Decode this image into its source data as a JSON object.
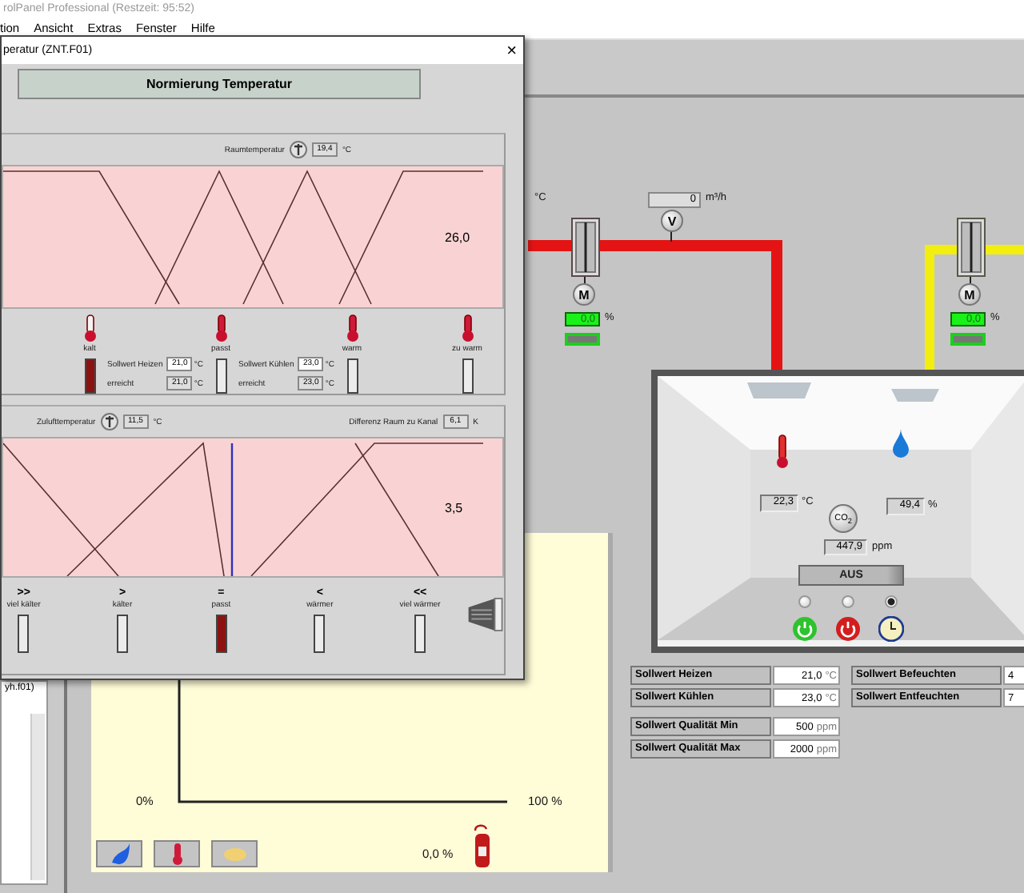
{
  "app": {
    "title": "rolPanel Professional (Restzeit: 95:52)",
    "menu": [
      "tion",
      "Ansicht",
      "Extras",
      "Fenster",
      "Hilfe"
    ]
  },
  "sidebar": {
    "items": [
      "yh.f01)"
    ]
  },
  "schematic": {
    "supply_unit": "°C",
    "flow": {
      "value": "0",
      "unit": "m³/h",
      "sensor": "V"
    },
    "dampers": [
      {
        "kind": "heating",
        "motor": "M",
        "reading": "0,0",
        "unit": "%"
      },
      {
        "kind": "cooling",
        "motor": "M",
        "reading": "0,0",
        "unit": "%"
      }
    ],
    "room": {
      "temperature": "22,3",
      "temperature_unit": "°C",
      "humidity": "49,4",
      "humidity_unit": "%",
      "co2_label": "CO$_{2}$",
      "co2": "447,9",
      "co2_unit": "ppm",
      "mode_button": "AUS",
      "modes": [
        {
          "kind": "on",
          "selected": false
        },
        {
          "kind": "off",
          "selected": false
        },
        {
          "kind": "timer",
          "selected": true
        }
      ]
    },
    "setpoints": [
      {
        "label": "Sollwert Heizen",
        "value": "21,0",
        "unit": "°C"
      },
      {
        "label": "Sollwert Kühlen",
        "value": "23,0",
        "unit": "°C"
      },
      {
        "label": "Sollwert Qualität Min",
        "value": "500",
        "unit": "ppm"
      },
      {
        "label": "Sollwert Qualität Max",
        "value": "2000",
        "unit": "ppm"
      }
    ],
    "setpoints_right": [
      {
        "label": "Sollwert Befeuchten",
        "value": "4"
      },
      {
        "label": "Sollwert Entfeuchten",
        "value": "7"
      }
    ],
    "chart": {
      "x_min": "0%",
      "x_max": "100 %",
      "reading": "0,0 %",
      "buttons": [
        {
          "kind": "humidity"
        },
        {
          "kind": "temperature"
        },
        {
          "kind": "co2"
        }
      ]
    }
  },
  "dialog": {
    "title": "peratur (ZNT.F01)",
    "close": "×",
    "heading": "Normierung Temperatur",
    "room": {
      "label": "Raumtemperatur",
      "value": "19,4",
      "unit": "°C",
      "scale_max": "26,0",
      "classes": [
        {
          "label": "kalt",
          "on": true
        },
        {
          "label": "passt",
          "on": false
        },
        {
          "label": "warm",
          "on": false
        },
        {
          "label": "zu warm",
          "on": false
        }
      ],
      "setpoints": [
        {
          "label": "Sollwert Heizen",
          "value": "21,0",
          "unit": "°C",
          "reached_label": "erreicht",
          "reached": "21,0",
          "reached_unit": "°C"
        },
        {
          "label": "Sollwert Kühlen",
          "value": "23,0",
          "unit": "°C",
          "reached_label": "erreicht",
          "reached": "23,0",
          "reached_unit": "°C"
        }
      ]
    },
    "supply": {
      "label": "Zulufttemperatur",
      "value": "11,5",
      "unit": "°C",
      "diff_label": "Differenz Raum zu Kanal",
      "diff": "6,1",
      "diff_unit": "K",
      "scale_max": "3,5",
      "classes": [
        {
          "symbol": ">>",
          "label": "viel kälter",
          "on": false
        },
        {
          "symbol": ">",
          "label": "kälter",
          "on": false
        },
        {
          "symbol": "=",
          "label": "passt",
          "on": true
        },
        {
          "symbol": "<",
          "label": "wärmer",
          "on": false
        },
        {
          "symbol": "<<",
          "label": "viel wärmer",
          "on": false
        }
      ]
    }
  }
}
